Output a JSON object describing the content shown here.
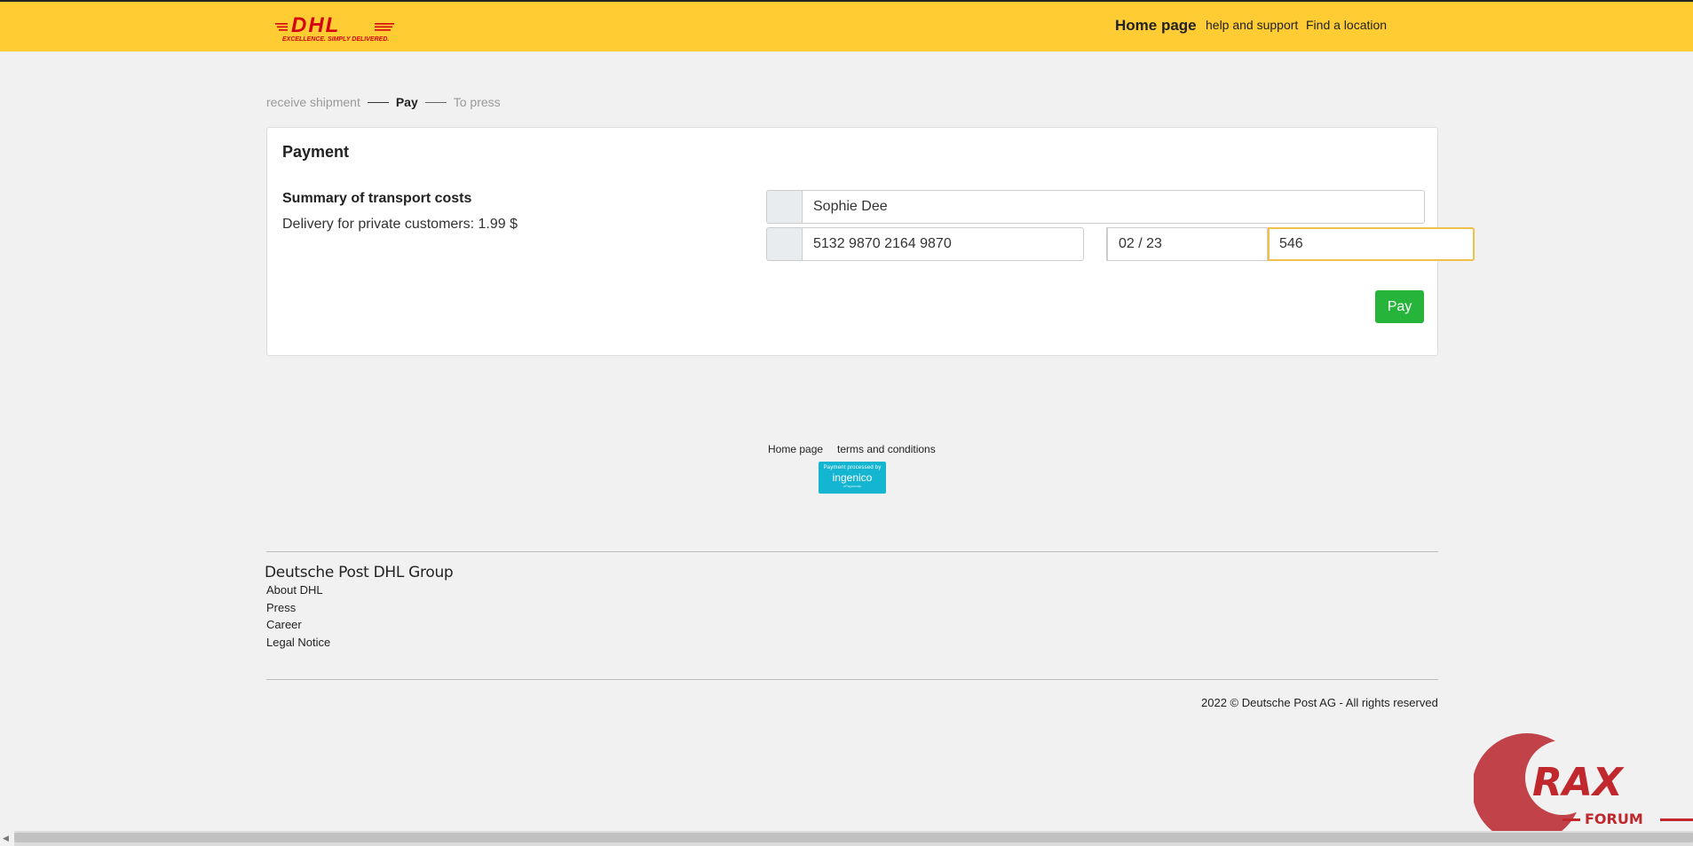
{
  "header": {
    "logo_text": "DHL",
    "logo_tagline": "EXCELLENCE. SIMPLY DELIVERED.",
    "nav_home": "Home page",
    "nav_help": "help and support",
    "nav_location": "Find a location",
    "nav_extra_icon": "",
    "brand_color": "#ffcc33",
    "logo_color": "#d40511"
  },
  "steps": {
    "step1": "receive shipment",
    "step2": "Pay",
    "step3": "To press"
  },
  "payment": {
    "title": "Payment",
    "summary_title": "Summary of transport costs",
    "summary_line": "Delivery for private customers: 1.99 $",
    "cardholder_value": "Sophie Dee",
    "card_number_value": "5132 9870 2164 9870",
    "expiry_value": "02 / 23",
    "cvv_value": "546",
    "addon_icon": "",
    "pay_label": "Pay",
    "pay_color": "#26b43a"
  },
  "footer": {
    "link_home": "Home page",
    "link_terms": "terms and conditions",
    "ingenico_top": "Payment processed by",
    "ingenico_main": "ingenico",
    "ingenico_sub": "ePayments",
    "group_title": "Deutsche Post DHL Group",
    "links": [
      "About DHL",
      "Press",
      "Career",
      "Legal Notice"
    ],
    "copyright": "2022 © Deutsche Post AG - All rights reserved"
  },
  "watermark": {
    "letters": "RAX",
    "word": "FORUM"
  }
}
